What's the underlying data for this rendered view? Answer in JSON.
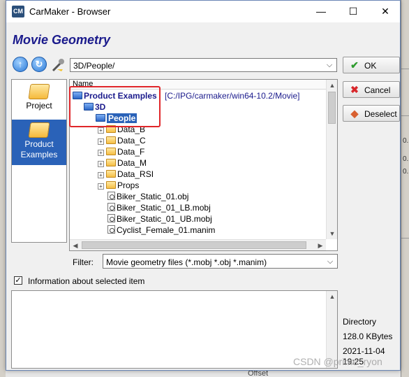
{
  "window": {
    "app_icon": "CM",
    "title": "CarMaker - Browser",
    "minimize": "—",
    "maximize": "☐",
    "close": "✕"
  },
  "dialog": {
    "title": "Movie Geometry"
  },
  "path": {
    "value": "3D/People/"
  },
  "buttons": {
    "ok": "OK",
    "cancel": "Cancel",
    "deselect": "Deselect"
  },
  "sidebar": {
    "items": [
      {
        "label": "Project"
      },
      {
        "label": "Product Examples",
        "selected": true
      }
    ]
  },
  "tree": {
    "column_header": "Name",
    "root_label": "Product Examples",
    "root_path": "[C:/IPG/carmaker/win64-10.2/Movie]",
    "child_3d": "3D",
    "selected": "People",
    "folders": [
      "Data_B",
      "Data_C",
      "Data_F",
      "Data_M",
      "Data_RSI",
      "Props"
    ],
    "files": [
      "Biker_Static_01.obj",
      "Biker_Static_01_LB.mobj",
      "Biker_Static_01_UB.mobj",
      "Cyclist_Female_01.manim"
    ]
  },
  "filter": {
    "label": "Filter:",
    "value": "Movie geometry files (*.mobj *.obj *.manim)"
  },
  "info": {
    "checkbox_label": "Information about selected item",
    "checked": true
  },
  "meta": {
    "type": "Directory",
    "size": "128.0 KBytes",
    "date": "2021-11-04",
    "time": "19:25"
  },
  "background": {
    "bottom_text": "Offset",
    "right_values": [
      "0.",
      "0.",
      "0."
    ]
  },
  "watermark": "CSDN @prime_ryon",
  "colors": {
    "title_blue": "#1a1a8c",
    "selection": "#2a62b8",
    "highlight_box": "#e0262a"
  }
}
